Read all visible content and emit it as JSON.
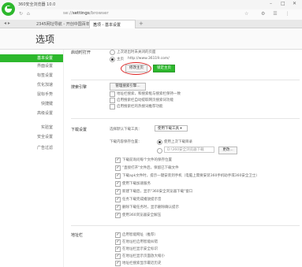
{
  "app": {
    "title": "360安全浏览器 10.0",
    "logo_icon": "360-logo"
  },
  "address": {
    "prefix": "se://",
    "path": "settings",
    "suffix": "/browser"
  },
  "tabs": [
    {
      "label": "2345网址导航 - 开创中国百年..."
    },
    {
      "label": "选项 - 基本设置"
    }
  ],
  "page_title": "选项",
  "sidebar": {
    "items": [
      {
        "label": "基本设置"
      },
      {
        "label": "界面设置"
      },
      {
        "label": "标签设置"
      },
      {
        "label": "优化加速"
      },
      {
        "label": "鼠标手势"
      },
      {
        "label": "快捷键"
      },
      {
        "label": "高级设置"
      },
      {
        "label": "实验室"
      },
      {
        "label": "安全设置"
      },
      {
        "label": "广告过滤"
      }
    ]
  },
  "startup": {
    "label": "启动时打开",
    "option1": "上次退出时未关闭的页面",
    "option2": "主页",
    "homepage_url": "http://www.36119.com/",
    "modify_button": "修改主页",
    "lock_button": "锁定主页"
  },
  "search": {
    "label": "搜索引擎",
    "manage_button": "管理搜索引擎...",
    "options": [
      "地址栏搜索，和搜索框与搜索栏保持一致",
      "启用搜索栏自动提取网页搜索词功能",
      "启用搜索栏的热搜词推荐功能"
    ]
  },
  "download": {
    "label": "下载设置",
    "tool_label": "选择默认下载工具：",
    "tool_value": "使用下载工具",
    "dir_label": "下载内容保存位置：",
    "dir_option1": "使用上次下载目录",
    "dir_path": "D:\\360安全浏览器下载",
    "browse_button": "更改...",
    "options": [
      "下载前询问每个文件的保存位置",
      "\"直接打开\"文件后，保留已下载文件",
      "下载apk文件时，提示一键安装到手机（电脑上需要安装360手机助手或360安全卫士）",
      "使用下载加速服务",
      "新建下载后，显示\"360安全浏览器下载\"窗口",
      "任务下载完成播放提示音",
      "删除下载任务时，显示删除确认提示",
      "使用360浏览器安全解压"
    ]
  },
  "addressbar": {
    "label": "地址栏",
    "options": [
      "启用智能网址（推荐）",
      "在地址栏启用智能纠错",
      "在地址栏显示安全标识",
      "在地址栏显示页面放大缩小",
      "地址栏搜索显示最近历史"
    ]
  },
  "colors": {
    "accent": "#2db82d",
    "highlight": "#d22222"
  }
}
